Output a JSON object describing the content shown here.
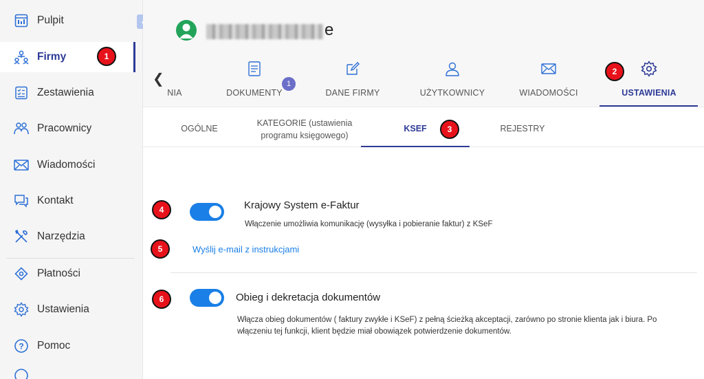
{
  "sidebar": {
    "items": [
      {
        "label": "Pulpit",
        "icon": "dashboard-icon"
      },
      {
        "label": "Firmy",
        "icon": "companies-icon",
        "active": true
      },
      {
        "label": "Zestawienia",
        "icon": "checklist-icon"
      },
      {
        "label": "Pracownicy",
        "icon": "employees-icon"
      },
      {
        "label": "Wiadomości",
        "icon": "envelope-icon"
      },
      {
        "label": "Kontakt",
        "icon": "chat-icon"
      },
      {
        "label": "Narzędzia",
        "icon": "tools-icon"
      },
      {
        "label": "Płatności",
        "icon": "payment-icon"
      },
      {
        "label": "Ustawienia",
        "icon": "gear-icon"
      },
      {
        "label": "Pomoc",
        "icon": "help-icon"
      }
    ]
  },
  "header": {
    "company_name_tail": "e"
  },
  "main_tabs": [
    {
      "label": "NIA"
    },
    {
      "label": "DOKUMENTY",
      "badge": "1"
    },
    {
      "label": "DANE FIRMY"
    },
    {
      "label": "UŻYTKOWNICY"
    },
    {
      "label": "WIADOMOŚCI"
    },
    {
      "label": "USTAWIENIA",
      "active": true
    }
  ],
  "sub_tabs": [
    {
      "label": "OGÓLNE"
    },
    {
      "label_line1": "KATEGORIE (ustawienia",
      "label_line2": "programu księgowego)"
    },
    {
      "label": "KSEF",
      "active": true
    },
    {
      "label": "REJESTRY"
    }
  ],
  "settings": {
    "ksef": {
      "title": "Krajowy System e-Faktur",
      "description": "Włączenie umożliwia komunikację (wysyłka i pobieranie faktur) z KSeF",
      "enabled": true,
      "link": "Wyślij e-mail z instrukcjami"
    },
    "workflow": {
      "title": "Obieg i dekretacja dokumentów",
      "description_line1": "Włącza obieg dokumentów ( faktury zwykłe i KSeF) z pełną ścieżką akceptacji, zarówno po stronie klienta jak i biura. Po",
      "description_line2": "włączeniu tej funkcji, klient będzie miał obowiązek potwierdzenie dokumentów.",
      "enabled": true
    }
  },
  "markers": [
    "1",
    "2",
    "3",
    "4",
    "5",
    "6"
  ],
  "colors": {
    "accent": "#2d3a96",
    "toggle_on": "#1a7fe6",
    "marker": "#e8121b",
    "avatar": "#23a45a"
  }
}
